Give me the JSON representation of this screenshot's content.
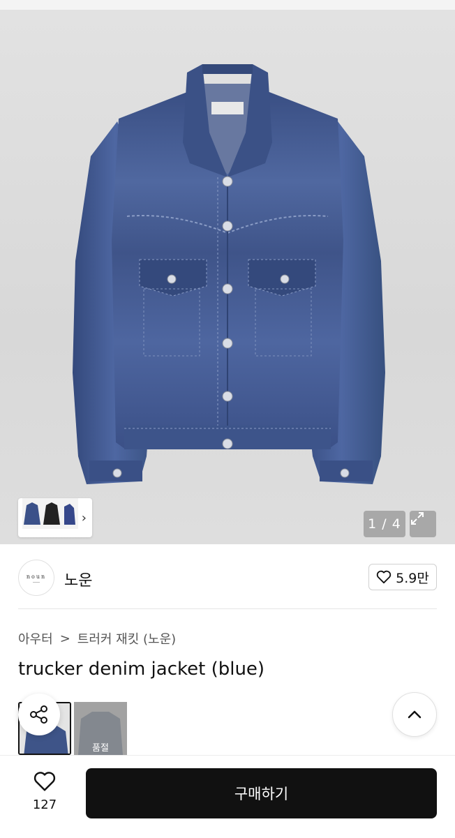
{
  "gallery": {
    "pager_text": "1 / 4",
    "thumbnails": [
      {
        "name": "front-jacket"
      },
      {
        "name": "black-jacket"
      },
      {
        "name": "blue-jacket-side"
      }
    ]
  },
  "brand": {
    "logo_text": "noun",
    "name": "노운",
    "likes": "5.9만"
  },
  "breadcrumb": {
    "category": "아우터",
    "separator": ">",
    "subcategory": "트러커 재킷 (노운)"
  },
  "product": {
    "title": "trucker denim jacket (blue)"
  },
  "swatches": [
    {
      "name": "blue",
      "selected": true,
      "label": ""
    },
    {
      "name": "grey",
      "selected": false,
      "label": "품절"
    }
  ],
  "bottom": {
    "wish_count": "127",
    "buy_label": "구매하기"
  },
  "colors": {
    "denim": "#3e5488",
    "buy_button": "#111111"
  }
}
